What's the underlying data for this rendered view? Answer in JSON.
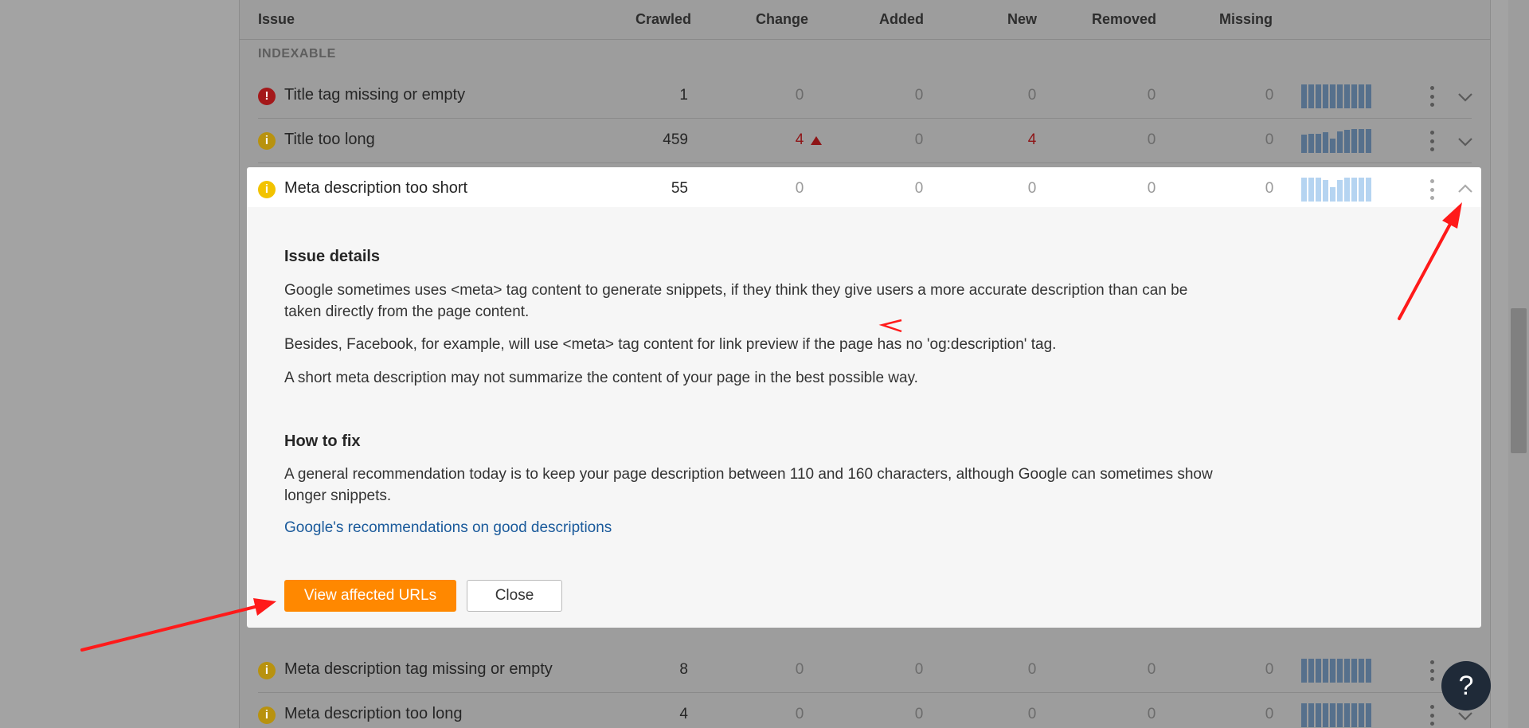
{
  "columns": {
    "issue": "Issue",
    "crawled": "Crawled",
    "change": "Change",
    "added": "Added",
    "new": "New",
    "removed": "Removed",
    "missing": "Missing"
  },
  "group_label": "INDEXABLE",
  "rows": [
    {
      "severity": "error",
      "severity_icon": "exclamation-icon",
      "name": "Title tag missing or empty",
      "crawled": "1",
      "change": "0",
      "added": "0",
      "new": "0",
      "removed": "0",
      "missing": "0",
      "trend": [
        1,
        1,
        1,
        1,
        1,
        1,
        1,
        1,
        1,
        1
      ]
    },
    {
      "severity": "warning",
      "severity_icon": "info-icon",
      "name": "Title too long",
      "crawled": "459",
      "change": "4",
      "change_direction": "up",
      "added": "0",
      "new": "4",
      "removed": "0",
      "missing": "0",
      "trend": [
        0.75,
        0.8,
        0.8,
        0.85,
        0.6,
        0.9,
        0.95,
        1,
        1,
        1
      ]
    },
    {
      "severity": "warning",
      "severity_icon": "info-icon",
      "name": "Meta description too short",
      "crawled": "55",
      "change": "0",
      "added": "0",
      "new": "0",
      "removed": "0",
      "missing": "0",
      "trend": [
        1,
        1,
        1,
        0.9,
        0.6,
        0.9,
        1,
        1,
        1,
        1
      ],
      "expanded": true
    },
    {
      "severity": "warning",
      "severity_icon": "info-icon",
      "name": "Meta description tag missing or empty",
      "crawled": "8",
      "change": "0",
      "added": "0",
      "new": "0",
      "removed": "0",
      "missing": "0",
      "trend": [
        1,
        1,
        1,
        1,
        1,
        1,
        1,
        1,
        1,
        1
      ]
    },
    {
      "severity": "warning",
      "severity_icon": "info-icon",
      "name": "Meta description too long",
      "crawled": "4",
      "change": "0",
      "added": "0",
      "new": "0",
      "removed": "0",
      "missing": "0",
      "trend": [
        1,
        1,
        1,
        1,
        1,
        1,
        1,
        1,
        1,
        1
      ]
    }
  ],
  "details": {
    "issue_details_heading": "Issue details",
    "p1_line1": "Google sometimes uses <meta> tag content to generate snippets, if they think they give users a more accurate description than can be",
    "p1_line2": "taken directly from the page content.",
    "p2": "Besides, Facebook, for example, will use <meta> tag content for link preview if the page has no 'og:description' tag.",
    "p3": "A short meta description may not summarize the content of your page in the best possible way.",
    "how_to_fix_heading": "How to fix",
    "fix_line1": "A general recommendation today is to keep your page description between 110 and 160 characters, although Google can sometimes show",
    "fix_line2": "longer snippets.",
    "link_text": "Google's recommendations on good descriptions",
    "primary_button": "View affected URLs",
    "secondary_button": "Close"
  },
  "help_button": "?",
  "colors": {
    "accent_orange": "#ff8800",
    "error_red": "#a4181a",
    "warning_yellow": "#f2c300",
    "link_blue": "#1a5a9b",
    "annotation_red": "#ff1a1a"
  }
}
